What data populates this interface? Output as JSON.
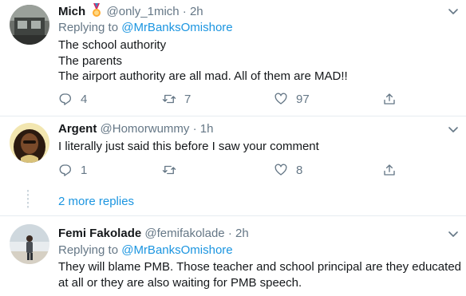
{
  "tweets": [
    {
      "name": "Mich",
      "badge_icon": "medal-icon",
      "handle": "@only_1mich",
      "separator": "·",
      "time": "2h",
      "replying_prefix": "Replying to",
      "replying_to": "@MrBanksOmishore",
      "lines": [
        "The school authority",
        "The parents",
        "The airport authority are all mad. All of them are MAD!!"
      ],
      "replies": "4",
      "retweets": "7",
      "likes": "97"
    },
    {
      "name": "Argent",
      "handle": "@Homorwummy",
      "separator": "·",
      "time": "1h",
      "lines": [
        "I literally just said this before I saw your comment"
      ],
      "replies": "1",
      "retweets": "",
      "likes": "8"
    },
    {
      "name": "Femi Fakolade",
      "handle": "@femifakolade",
      "separator": "·",
      "time": "2h",
      "replying_prefix": "Replying to",
      "replying_to": "@MrBanksOmishore",
      "lines": [
        "They will blame PMB. Those teacher and school principal are they educated",
        "at all or they are also waiting for PMB speech."
      ]
    }
  ],
  "more_replies": "2 more replies",
  "colors": {
    "link": "#1b95e0",
    "secondary": "#657786",
    "text": "#14171a",
    "border": "#e6ecf0"
  }
}
